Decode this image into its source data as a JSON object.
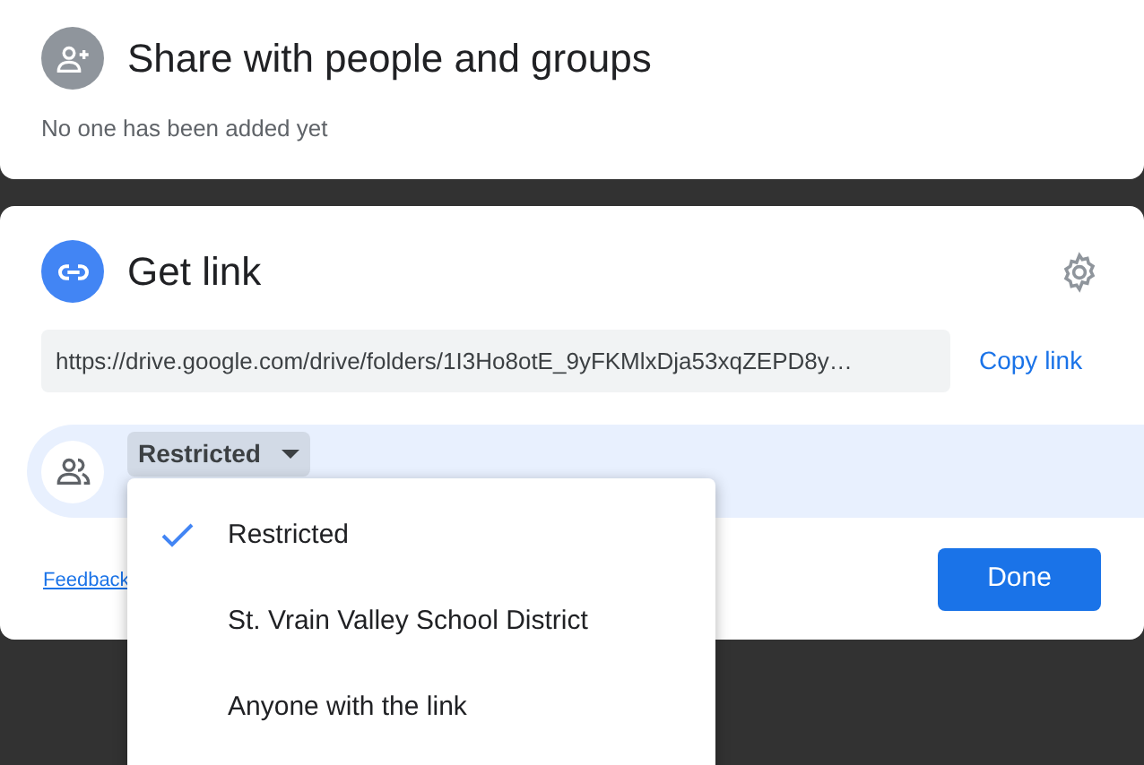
{
  "share_section": {
    "title": "Share with people and groups",
    "subtitle": "No one has been added yet"
  },
  "link_section": {
    "title": "Get link",
    "url": "https://drive.google.com/drive/folders/1I3Ho8otE_9yFKMlxDja53xqZEPD8y…",
    "copy_label": "Copy link",
    "access_dropdown": {
      "value": "Restricted",
      "expanded": true
    },
    "feedback_label": "Feedback",
    "done_label": "Done"
  },
  "access_menu": [
    {
      "label": "Restricted",
      "selected": true
    },
    {
      "label": "St. Vrain Valley School District",
      "selected": false
    },
    {
      "label": "Anyone with the link",
      "selected": false
    }
  ]
}
